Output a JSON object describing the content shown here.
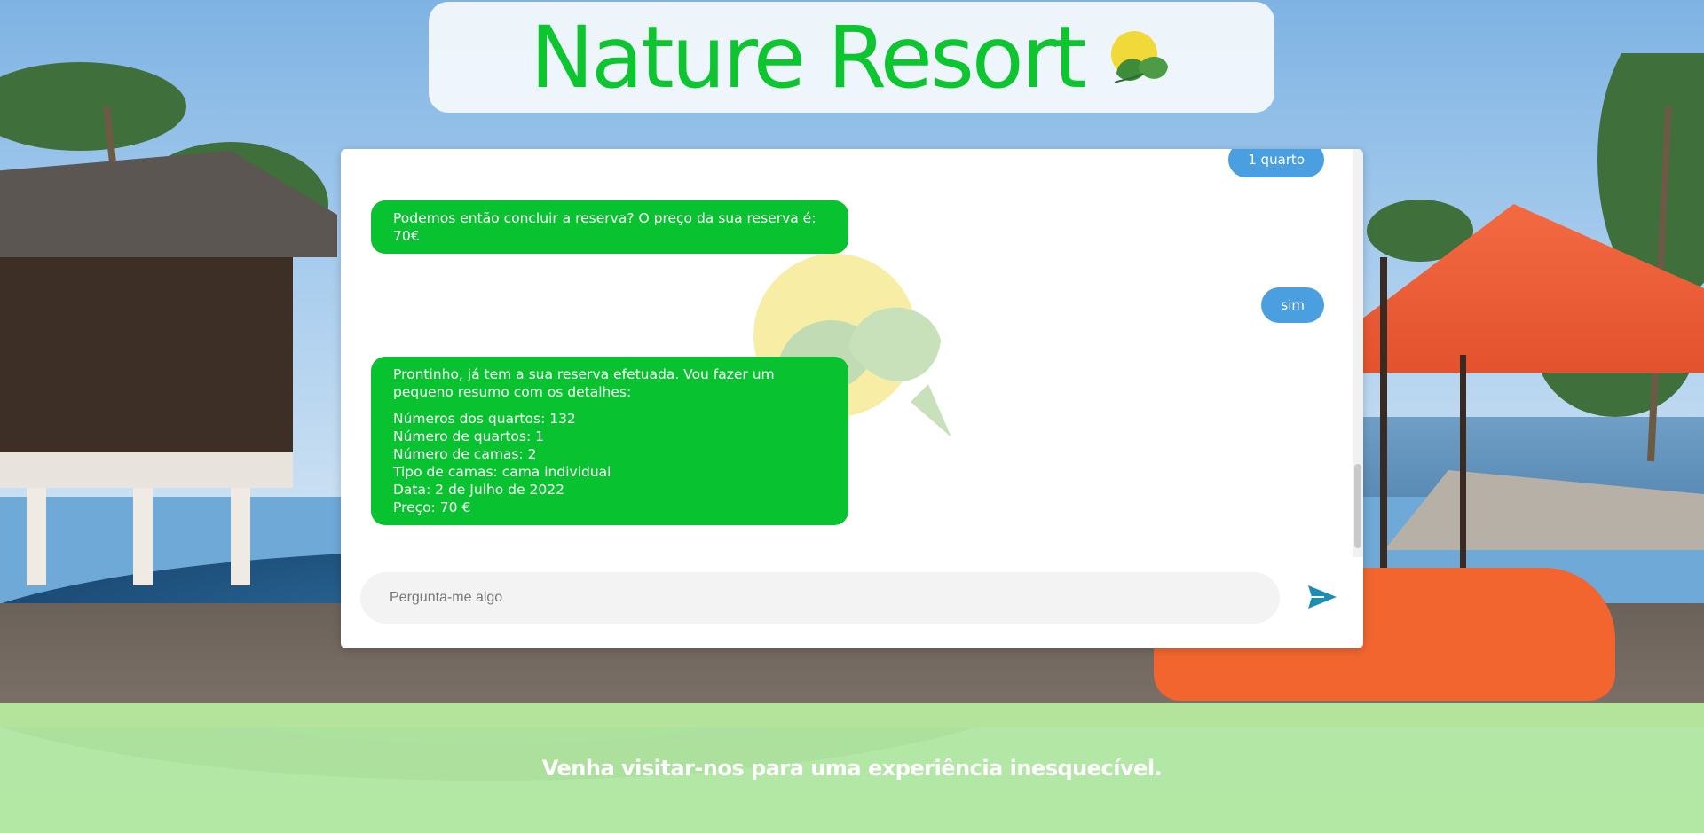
{
  "header": {
    "title": "Nature Resort",
    "logo_icon": "sun-leaf-icon"
  },
  "chat": {
    "messages": [
      {
        "role": "user",
        "text": "1 quarto"
      },
      {
        "role": "bot",
        "paragraphs": [
          [
            "Podemos então concluir a reserva? O preço da sua reserva é: 70€"
          ]
        ]
      },
      {
        "role": "user",
        "text": "sim"
      },
      {
        "role": "bot",
        "paragraphs": [
          [
            "Prontinho, já tem a sua reserva efetuada. Vou fazer um pequeno resumo com os detalhes:"
          ],
          [
            "Números dos quartos: 132",
            "Número de quartos: 1",
            "Número de camas: 2",
            "Tipo de camas: cama individual",
            "Data: 2 de Julho de 2022",
            "Preço: 70 €"
          ]
        ]
      }
    ],
    "input": {
      "placeholder": "Pergunta-me algo",
      "value": ""
    },
    "send_icon": "send-arrow-icon",
    "watermark_icon": "sun-leaf-icon"
  },
  "footer": {
    "text": "Venha visitar-nos para uma experiência inesquecível."
  },
  "colors": {
    "brand_green": "#0cc52f",
    "bot_bubble": "#08c22f",
    "user_bubble": "#4a9fe0",
    "send_icon": "#1b8fb3",
    "footer_bg": "#b8eca0"
  }
}
